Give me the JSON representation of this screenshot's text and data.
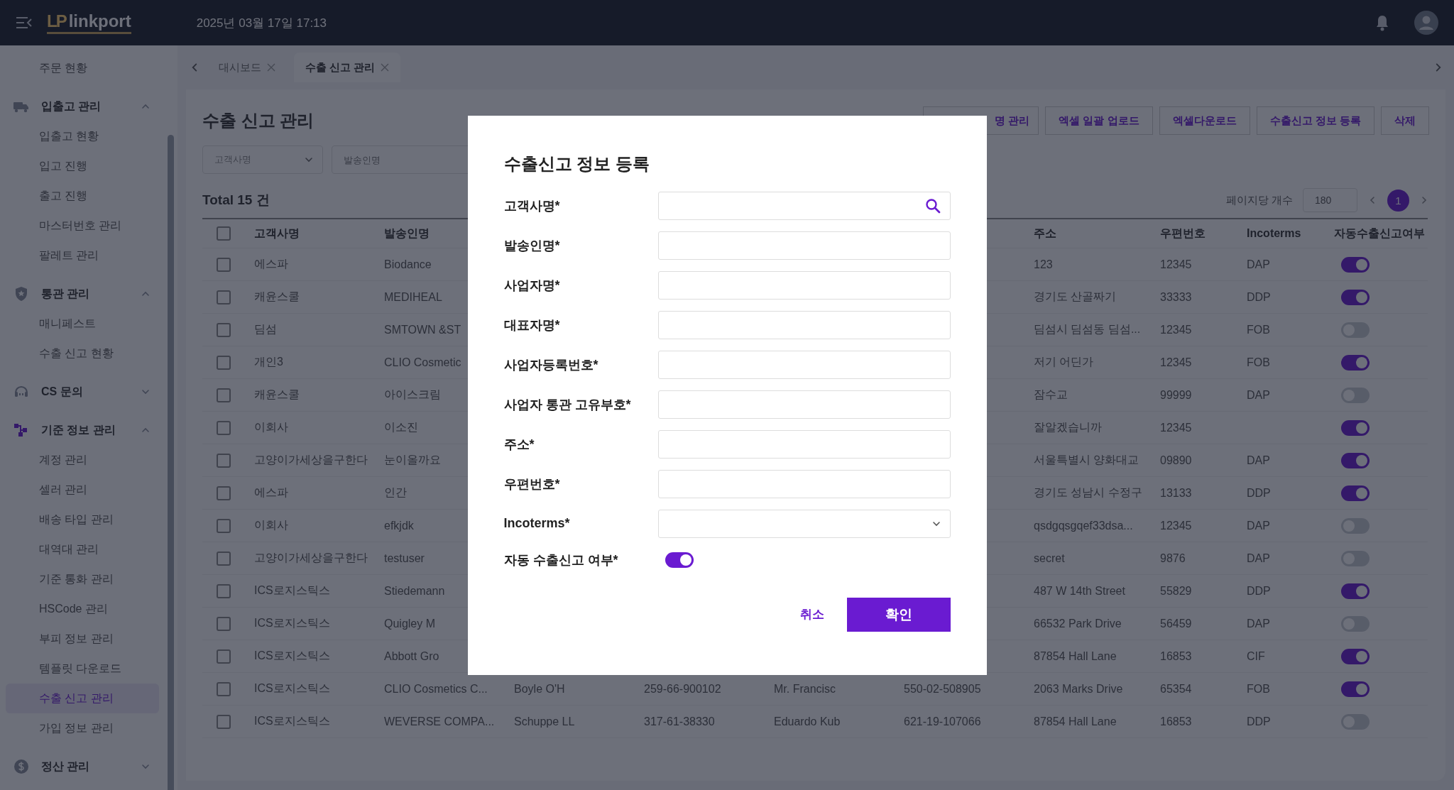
{
  "top_bar": {
    "logo_mark": "LP",
    "logo_text": "linkport",
    "datetime": "2025년 03월 17일 17:13"
  },
  "sidebar": {
    "items": [
      {
        "kind": "link",
        "label": "주문 현황",
        "selected": false
      },
      {
        "kind": "group",
        "label": "입출고 관리",
        "active": false,
        "expanded": true,
        "children": [
          {
            "label": "입출고 현황",
            "selected": false
          },
          {
            "label": "입고 진행",
            "selected": false
          },
          {
            "label": "출고 진행",
            "selected": false
          },
          {
            "label": "마스터번호 관리",
            "selected": false
          },
          {
            "label": "팔레트 관리",
            "selected": false
          }
        ]
      },
      {
        "kind": "group",
        "label": "통관 관리",
        "active": false,
        "expanded": true,
        "children": [
          {
            "label": "매니페스트",
            "selected": false
          },
          {
            "label": "수출 신고 현황",
            "selected": false
          }
        ]
      },
      {
        "kind": "group",
        "label": "CS 문의",
        "active": false,
        "expanded": false
      },
      {
        "kind": "group",
        "label": "기준 정보 관리",
        "active": true,
        "expanded": true,
        "children": [
          {
            "label": "계정 관리",
            "selected": false
          },
          {
            "label": "셀러 관리",
            "selected": false
          },
          {
            "label": "배송 타입 관리",
            "selected": false
          },
          {
            "label": "대역대 관리",
            "selected": false
          },
          {
            "label": "기준 통화 관리",
            "selected": false
          },
          {
            "label": "HSCode 관리",
            "selected": false
          },
          {
            "label": "부피 정보 관리",
            "selected": false
          },
          {
            "label": "템플릿 다운로드",
            "selected": false
          },
          {
            "label": "수출 신고 관리",
            "selected": true
          },
          {
            "label": "가입 정보 관리",
            "selected": false
          }
        ]
      },
      {
        "kind": "group",
        "label": "정산 관리",
        "active": false,
        "expanded": false
      }
    ]
  },
  "tabs": [
    {
      "label": "대시보드",
      "selected": false
    },
    {
      "label": "수출 신고 관리",
      "selected": true
    }
  ],
  "page": {
    "title": "수출 신고 관리",
    "actions": [
      {
        "label": "명 관리",
        "kind": "partial"
      },
      {
        "label": "엑셀 일괄 업로드",
        "kind": "full"
      },
      {
        "label": "엑셀다운로드",
        "kind": "full"
      },
      {
        "label": "수출신고 정보 등록",
        "kind": "full"
      },
      {
        "label": "삭제",
        "kind": "full"
      }
    ],
    "filters": [
      {
        "kind": "select",
        "placeholder": "고객사명"
      },
      {
        "kind": "input",
        "placeholder": "발송인명"
      }
    ],
    "total": "Total 15 건",
    "pagination": {
      "label": "페이지당 개수",
      "page_size": "180",
      "pages": [
        {
          "label": "1",
          "selected": true
        }
      ]
    }
  },
  "table": {
    "select_all_checked": false,
    "columns": [
      {
        "label": "고객사명"
      },
      {
        "label": "발송인명"
      },
      {
        "label": "주소"
      },
      {
        "label": "우편번호"
      },
      {
        "label": "Incoterms"
      },
      {
        "label": "자동수출신고여부"
      }
    ],
    "rows": [
      {
        "checked": false,
        "customer": "에스파",
        "sender": "Biodance",
        "address": "123",
        "postal_code": "12345",
        "incoterms": "DAP",
        "auto_declare": true
      },
      {
        "checked": false,
        "customer": "캐윤스쿨",
        "sender": "MEDIHEAL",
        "address": "경기도 산골짜기",
        "postal_code": "33333",
        "incoterms": "DDP",
        "auto_declare": true
      },
      {
        "checked": false,
        "customer": "딤섬",
        "sender": "SMTOWN &ST",
        "address": "딤섬시 딤섬동 딤섬...",
        "postal_code": "12345",
        "incoterms": "FOB",
        "auto_declare": false
      },
      {
        "checked": false,
        "customer": "개인3",
        "sender": "CLIO Cosmetic",
        "address": "저기 어딘가",
        "postal_code": "12345",
        "incoterms": "FOB",
        "auto_declare": true
      },
      {
        "checked": false,
        "customer": "캐윤스쿨",
        "sender": "아이스크림",
        "address": "잠수교",
        "postal_code": "99999",
        "incoterms": "DAP",
        "auto_declare": false
      },
      {
        "checked": false,
        "customer": "이회사",
        "sender": "이소진",
        "address": "잘알겠습니까",
        "postal_code": "12345",
        "auto_declare": true
      },
      {
        "checked": false,
        "customer": "고양이가세상을구한다",
        "sender": "눈이올까요",
        "address": "서울특별시 양화대교",
        "postal_code": "09890",
        "incoterms": "DAP",
        "auto_declare": true
      },
      {
        "checked": false,
        "customer": "에스파",
        "sender": "인간",
        "address": "경기도 성남시 수정구",
        "postal_code": "13133",
        "incoterms": "DDP",
        "auto_declare": true
      },
      {
        "checked": false,
        "customer": "이회사",
        "sender": "efkjdk",
        "address": "qsdgqsgqef33dsa...",
        "postal_code": "12345",
        "incoterms": "DAP",
        "auto_declare": false
      },
      {
        "checked": false,
        "customer": "고양이가세상을구한다",
        "sender": "testuser",
        "address": "secret",
        "postal_code": "9876",
        "incoterms": "DAP",
        "auto_declare": false
      },
      {
        "checked": false,
        "customer": "ICS로지스틱스",
        "sender": "Stiedemann",
        "address": "487 W 14th Street",
        "postal_code": "55829",
        "incoterms": "DDP",
        "auto_declare": true
      },
      {
        "checked": false,
        "customer": "ICS로지스틱스",
        "sender": "Quigley M",
        "address": "66532 Park Drive",
        "postal_code": "56459",
        "incoterms": "DAP",
        "auto_declare": false
      },
      {
        "checked": false,
        "customer": "ICS로지스틱스",
        "sender": "Abbott Gro",
        "address": "87854 Hall Lane",
        "postal_code": "16853",
        "incoterms": "CIF",
        "auto_declare": true
      },
      {
        "checked": false,
        "customer": "ICS로지스틱스",
        "sender": "CLIO Cosmetics C...",
        "column_3": "Boyle O'H",
        "column_4": "259-66-900102",
        "column_5": "Mr. Francisc",
        "column_6": "550-02-508905",
        "address": "2063 Marks Drive",
        "postal_code": "65354",
        "incoterms": "FOB",
        "auto_declare": true
      },
      {
        "checked": false,
        "customer": "ICS로지스틱스",
        "sender": "WEVERSE COMPA...",
        "column_3": "Schuppe LL",
        "column_4": "317-61-38330",
        "column_5": "Eduardo Kub",
        "column_6": "621-19-107066",
        "address": "87854 Hall Lane",
        "postal_code": "16853",
        "incoterms": "DDP",
        "auto_declare": false
      }
    ]
  },
  "modal": {
    "title": "수출신고 정보 등록",
    "fields": [
      {
        "label": "고객사명*",
        "kind": "search"
      },
      {
        "label": "발송인명*",
        "kind": "text"
      },
      {
        "label": "사업자명*",
        "kind": "text"
      },
      {
        "label": "대표자명*",
        "kind": "text"
      },
      {
        "label": "사업자등록번호*",
        "kind": "text"
      },
      {
        "label": "사업자 통관 고유부호*",
        "kind": "text"
      },
      {
        "label": "주소*",
        "kind": "text"
      },
      {
        "label": "우편번호*",
        "kind": "text"
      },
      {
        "label": "Incoterms*",
        "kind": "select"
      },
      {
        "label": "자동 수출신고 여부*",
        "kind": "toggle",
        "on": true
      }
    ],
    "buttons": [
      {
        "label": "취소",
        "kind": "text"
      },
      {
        "label": "확인",
        "kind": "primary"
      }
    ]
  }
}
